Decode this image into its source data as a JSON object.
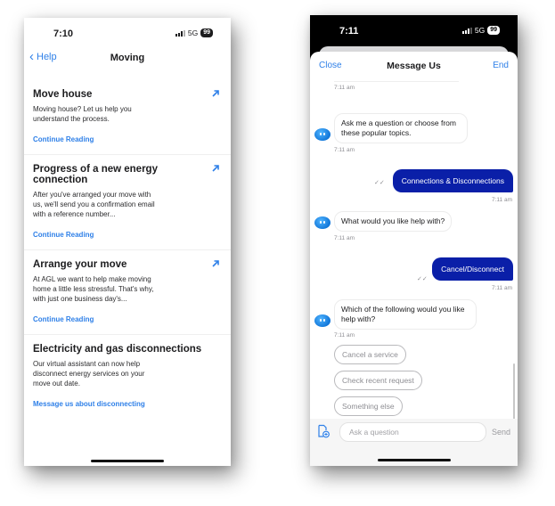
{
  "left_phone": {
    "status": {
      "time": "7:10",
      "network": "5G",
      "battery": "99"
    },
    "nav": {
      "back_label": "Help",
      "title": "Moving"
    },
    "articles": [
      {
        "title": "Move house",
        "body": "Moving house? Let us help you understand the process.",
        "link": "Continue Reading",
        "icon": "external-arrow-icon"
      },
      {
        "title": "Progress of a new energy connection",
        "body": "After you've arranged your move with us, we'll send you a confirmation email with a reference number...",
        "link": "Continue Reading",
        "icon": "external-arrow-icon"
      },
      {
        "title": "Arrange your move",
        "body": "At AGL we want to help make moving home a little less stressful. That's why, with just one business day's...",
        "link": "Continue Reading",
        "icon": "external-arrow-icon"
      },
      {
        "title": "Electricity and gas disconnections",
        "body": "Our virtual assistant can now help disconnect energy services on your move out date.",
        "link": "Message us about disconnecting"
      }
    ]
  },
  "right_phone": {
    "status": {
      "time": "7:11",
      "network": "5G",
      "battery": "99"
    },
    "header": {
      "close_label": "Close",
      "title": "Message Us",
      "end_label": "End"
    },
    "messages": [
      {
        "from": "bot",
        "timestamp": "7:11 am"
      },
      {
        "from": "bot",
        "text": "Ask me a question or choose from these popular topics.",
        "timestamp": "7:11 am"
      },
      {
        "from": "user",
        "text": "Connections & Disconnections",
        "timestamp": "7:11 am",
        "read_receipt": "✓✓"
      },
      {
        "from": "bot",
        "text": "What would you like help with?",
        "timestamp": "7:11 am"
      },
      {
        "from": "user",
        "text": "Cancel/Disconnect",
        "timestamp": "7:11 am",
        "read_receipt": "✓✓"
      },
      {
        "from": "bot",
        "text": "Which of the following would you like help with?",
        "timestamp": "7:11 am"
      }
    ],
    "quick_replies": [
      "Cancel a service",
      "Check recent request",
      "Something else"
    ],
    "composer": {
      "placeholder": "Ask a question",
      "send_label": "Send"
    }
  },
  "colors": {
    "link_blue": "#2f80e8",
    "user_bubble": "#0a1fa8",
    "bot_avatar": "#1a8cf0"
  }
}
